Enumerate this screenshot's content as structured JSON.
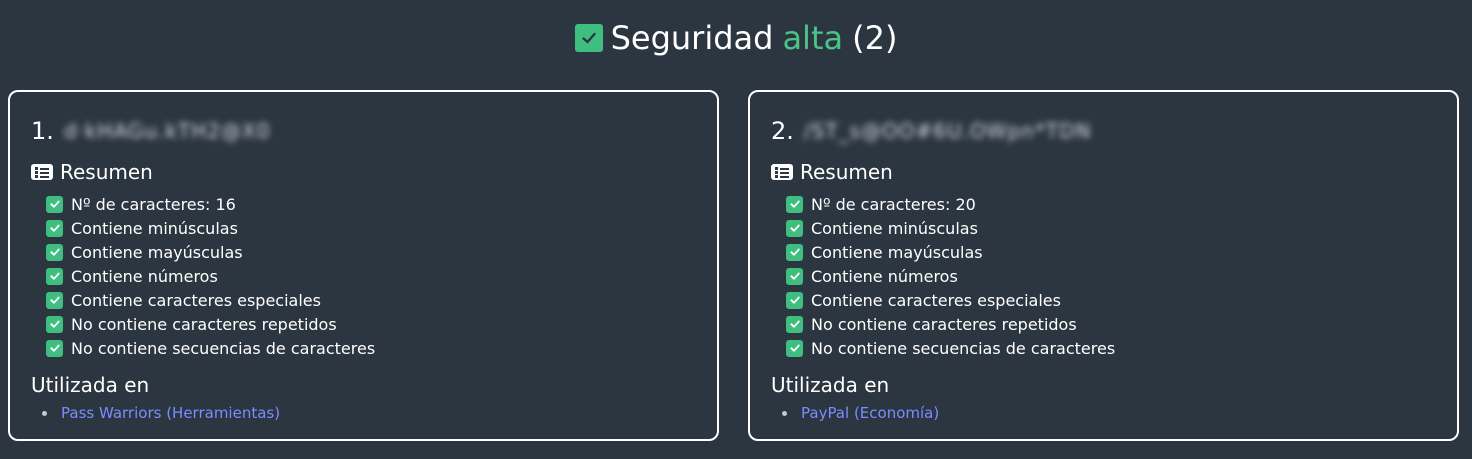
{
  "header": {
    "title": "Seguridad",
    "level": "alta",
    "count": "(2)"
  },
  "colors": {
    "background": "#2b3640",
    "accent_green": "#3fbf7f",
    "link_blue": "#7c8cff",
    "card_border": "#ffffff"
  },
  "cards": [
    {
      "number": "1.",
      "password_masked": "d·kHAGu.kTH2@X0",
      "summary_title": "Resumen",
      "summary_icon": "list-icon",
      "checks": [
        "Nº de caracteres: 16",
        "Contiene minúsculas",
        "Contiene mayúsculas",
        "Contiene números",
        "Contiene caracteres especiales",
        "No contiene caracteres repetidos",
        "No contiene secuencias de caracteres"
      ],
      "used_in_title": "Utilizada en",
      "used_in": [
        "Pass Warriors (Herramientas)"
      ]
    },
    {
      "number": "2.",
      "password_masked": "/ST_s@OO#6U.OWpn*TDN",
      "summary_title": "Resumen",
      "summary_icon": "list-icon",
      "checks": [
        "Nº de caracteres: 20",
        "Contiene minúsculas",
        "Contiene mayúsculas",
        "Contiene números",
        "Contiene caracteres especiales",
        "No contiene caracteres repetidos",
        "No contiene secuencias de caracteres"
      ],
      "used_in_title": "Utilizada en",
      "used_in": [
        "PayPal (Economía)"
      ]
    }
  ]
}
